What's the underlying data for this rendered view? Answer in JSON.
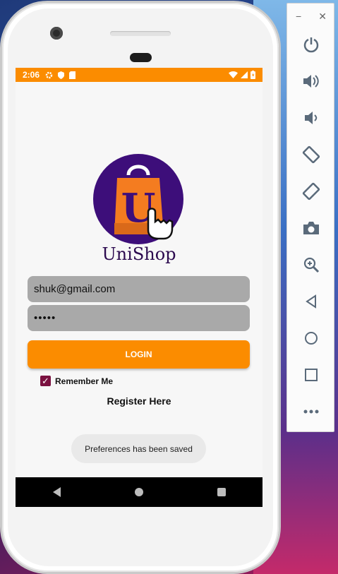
{
  "status_bar": {
    "time": "2:06"
  },
  "app": {
    "brand_name": "UniShop",
    "logo_letter": "U",
    "email_value": "shuk@gmail.com",
    "password_masked": "•••••",
    "login_label": "LOGIN",
    "remember_label": "Remember Me",
    "remember_checked": true,
    "register_label": "Register Here",
    "toast_text": "Preferences has been saved"
  },
  "colors": {
    "accent": "#fb8c00",
    "logo_circle": "#3d0e7a",
    "field_bg": "#a9a9a9",
    "checkbox": "#7a1140"
  },
  "toolbar": {
    "minimize": "−",
    "close": "✕",
    "items": [
      "power-icon",
      "volume-up-icon",
      "volume-down-icon",
      "rotate-left-icon",
      "rotate-right-icon",
      "camera-icon",
      "zoom-icon",
      "back-icon",
      "home-icon",
      "overview-icon",
      "more-icon"
    ]
  }
}
